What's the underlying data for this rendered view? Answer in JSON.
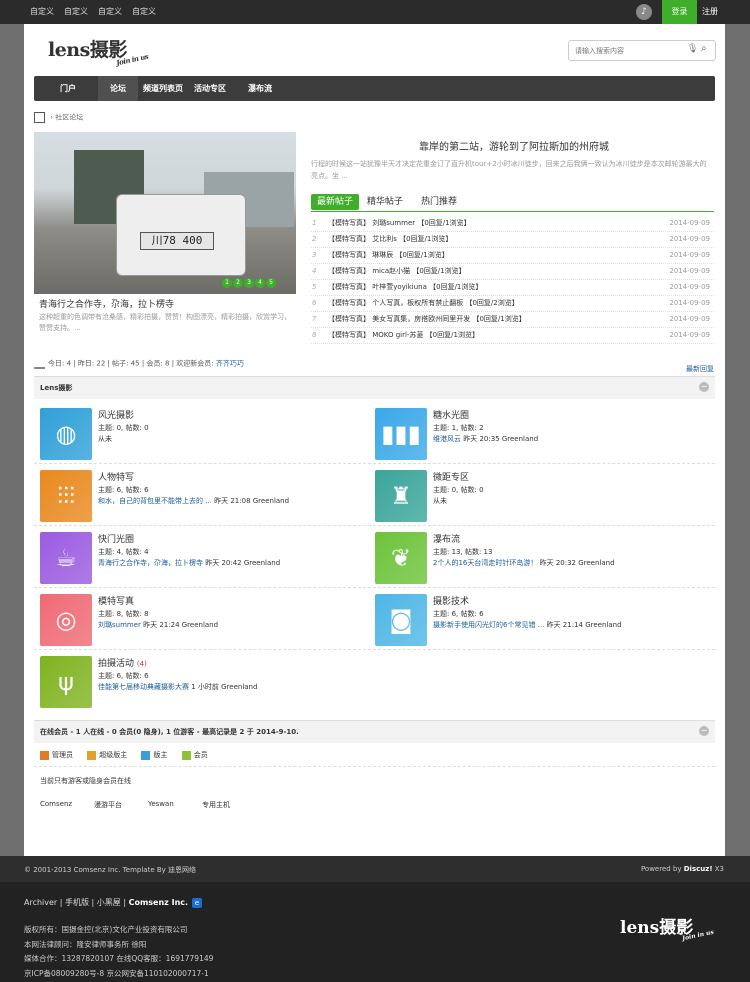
{
  "topbar": {
    "links": [
      "自定义",
      "自定义",
      "自定义",
      "自定义"
    ],
    "login": "登录",
    "register": "注册"
  },
  "logo": {
    "main": "lens摄影",
    "sub": "Join in us"
  },
  "search": {
    "placeholder": "请输入搜索内容"
  },
  "nav": [
    "门户",
    "论坛",
    "频道列表页",
    "活动专区",
    "瀑布流"
  ],
  "breadcrumb": "社区论坛",
  "slider": {
    "plate": "川78 400",
    "dots": [
      "1",
      "2",
      "3",
      "4",
      "5"
    ],
    "title": "青海行之合作寺，尕海，拉卜楞寺",
    "desc": "这种超重的色调带有沧桑感，精彩拍摄，赞赞！构图漂亮，精彩拍摄，欣赏学习，赞赞支持。..."
  },
  "headline": {
    "title": "靠岸的第二站，游轮到了阿拉斯加的州府城",
    "desc": "行程的时候这一站犹豫半天才决定花重金订了直升机tour+2小时冰川徒步，回来之后我俩一致认为冰川徒步是本次邮轮游最大的亮点。坐 ..."
  },
  "tabs": [
    "最新帖子",
    "精华帖子",
    "热门推荐"
  ],
  "threads": [
    {
      "n": "1",
      "t": "【模特写真】 刘璐summer 【0回复/1浏览】",
      "d": "2014-09-09"
    },
    {
      "n": "2",
      "t": "【模特写真】 艾比利s 【0回复/1浏览】",
      "d": "2014-09-09"
    },
    {
      "n": "3",
      "t": "【模特写真】 琳琳辰 【0回复/1浏览】",
      "d": "2014-09-09"
    },
    {
      "n": "4",
      "t": "【模特写真】 mica赵小猫 【0回复/1浏览】",
      "d": "2014-09-09"
    },
    {
      "n": "5",
      "t": "【模特写真】 叶梓萱yoyikiuna 【0回复/1浏览】",
      "d": "2014-09-09"
    },
    {
      "n": "6",
      "t": "【模特写真】 个人写真，板权所有禁止翻板 【0回复/2浏览】",
      "d": "2014-09-09"
    },
    {
      "n": "7",
      "t": "【模特写真】 美女写真集，房搭欧州同里开发 【0回复/1浏览】",
      "d": "2014-09-09"
    },
    {
      "n": "8",
      "t": "【模特写真】 MOKO girl-苏菱 【0回复/1浏览】",
      "d": "2014-09-09"
    }
  ],
  "stats": {
    "text": "今日: 4 | 昨日: 22 | 帖子: 45 | 会员: 8 | 欢迎新会员: ",
    "member": "齐齐巧巧",
    "latest": "最新回复"
  },
  "section": {
    "title": "Lens摄影"
  },
  "forums": [
    {
      "name": "风光摄影",
      "count": "",
      "stats": "主题: 0, 帖数: 0",
      "link": "",
      "last": "从未",
      "color": "#2fa0d8",
      "icon": "basketball-icon",
      "glyph": "◍"
    },
    {
      "name": "糖水光圈",
      "count": "",
      "stats": "主题: 1, 帖数: 2",
      "link": "维港风云",
      "last": " 昨天 20:35 Greenland",
      "color": "#3aa8e8",
      "icon": "bar-chart-icon",
      "glyph": "▮▮▮"
    },
    {
      "name": "人物特写",
      "count": "",
      "stats": "主题: 6, 帖数: 6",
      "link": "和水，自己的背包里不能带上去的 ...",
      "last": " 昨天 21:08 Greenland",
      "color": "#e8891e",
      "icon": "sliders-icon",
      "glyph": "⫶⫶⫶"
    },
    {
      "name": "微距专区",
      "count": "",
      "stats": "主题: 0, 帖数: 0",
      "link": "",
      "last": "从未",
      "color": "#3aa59a",
      "icon": "castle-icon",
      "glyph": "♜"
    },
    {
      "name": "快门光圈",
      "count": "",
      "stats": "主题: 4, 帖数: 4",
      "link": "青海行之合作寺，尕海，拉卜楞寺",
      "last": " 昨天 20:42 Greenland",
      "color": "#9b5be0",
      "icon": "coffee-cup-icon",
      "glyph": "☕"
    },
    {
      "name": "瀑布流",
      "count": "",
      "stats": "主题: 13, 帖数: 13",
      "link": "2个人的16天台湾走时针环岛游！",
      "last": " 昨天 20:32 Greenland",
      "color": "#6cc33a",
      "icon": "plant-icon",
      "glyph": "❦"
    },
    {
      "name": "模特写真",
      "count": "",
      "stats": "主题: 8, 帖数: 8",
      "link": "刘璐summer",
      "last": " 昨天 21:24 Greenland",
      "color": "#ef6a74",
      "icon": "rings-icon",
      "glyph": "◎"
    },
    {
      "name": "摄影技术",
      "count": "",
      "stats": "主题: 6, 帖数: 6",
      "link": "摄影新手使用闪光灯的6个常见错 ...",
      "last": " 昨天 21:14 Greenland",
      "color": "#4fb6e6",
      "icon": "camera-icon",
      "glyph": "◙"
    },
    {
      "name": "拍摄活动",
      "count": "(4)",
      "stats": "主题: 6, 帖数: 6",
      "link": "佳能第七届移动典藏摄影大赛",
      "last": " 1 小时前 Greenland",
      "color": "#7fb320",
      "icon": "cutlery-icon",
      "glyph": "ψ"
    }
  ],
  "online": {
    "title": "在线会员 - 1 人在线 - 0 会员(0 隐身), 1 位游客 - 最高记录是 2 于 2014-9-10.",
    "legend": [
      {
        "label": "管理员",
        "color": "#e07b2a"
      },
      {
        "label": "超级版主",
        "color": "#e0a32a"
      },
      {
        "label": "版主",
        "color": "#3a9fd8"
      },
      {
        "label": "会员",
        "color": "#8fc23a"
      }
    ],
    "note": "当前只有游客或隐身会员在线"
  },
  "friend_links": [
    "Comsenz",
    "漫游平台",
    "Yeswan",
    "专用主机"
  ],
  "footer": {
    "copyright": "© 2001-2013 Comsenz Inc.  Template By 迪恩网络",
    "powered": "Powered by ",
    "discuz": "Discuz!",
    "version": " X3",
    "links": "Archiver | 手机版 | 小黑屋 | ",
    "company": "Comsenz Inc.",
    "info": [
      "版权所有：国摄金控(北京)文化产业投资有限公司",
      "本网法律顾问：隆安律师事务所 徐阳",
      "媒体合作：13287820107 在线QQ客服：1691779149",
      "京ICP备08009280号-8 京公网安备110102000717-1"
    ]
  }
}
